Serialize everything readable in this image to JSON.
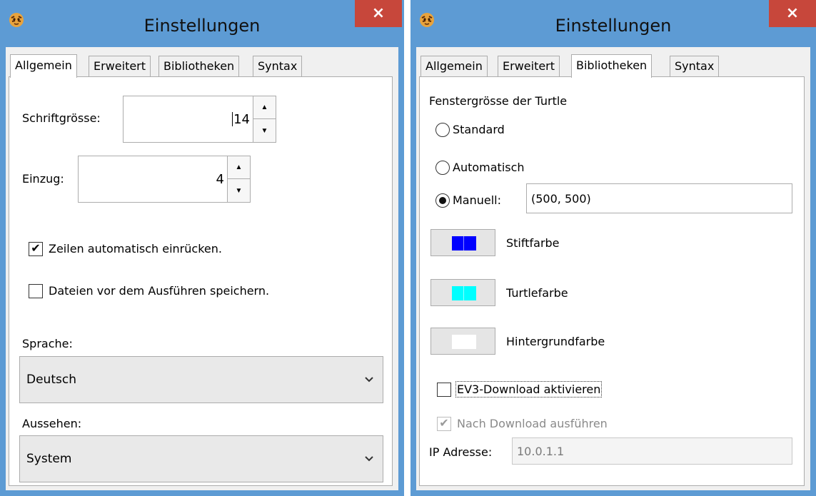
{
  "left_window": {
    "title": "Einstellungen",
    "close_glyph": "×",
    "tabs": [
      {
        "label": "Allgemein",
        "active": true
      },
      {
        "label": "Erweitert",
        "active": false
      },
      {
        "label": "Bibliotheken",
        "active": false
      },
      {
        "label": "Syntax",
        "active": false
      }
    ],
    "font_size": {
      "label": "Schriftgrösse:",
      "value": "14"
    },
    "indent": {
      "label": "Einzug:",
      "value": "4"
    },
    "auto_indent": {
      "label": "Zeilen automatisch einrücken.",
      "checked": true
    },
    "save_before_run": {
      "label": "Dateien vor dem Ausführen speichern.",
      "checked": false
    },
    "language": {
      "label": "Sprache:",
      "value": "Deutsch"
    },
    "appearance": {
      "label": "Aussehen:",
      "value": "System"
    }
  },
  "right_window": {
    "title": "Einstellungen",
    "close_glyph": "×",
    "tabs": [
      {
        "label": "Allgemein",
        "active": false
      },
      {
        "label": "Erweitert",
        "active": false
      },
      {
        "label": "Bibliotheken",
        "active": true
      },
      {
        "label": "Syntax",
        "active": false
      }
    ],
    "turtle_window_size": {
      "label": "Fenstergrösse der Turtle",
      "standard": "Standard",
      "automatic": "Automatisch",
      "manual": "Manuell:",
      "selected": "manual",
      "manual_value": "(500, 500)"
    },
    "pen_color": {
      "label": "Stiftfarbe",
      "color": "#0000ff"
    },
    "turtle_color": {
      "label": "Turtlefarbe",
      "color": "#00ffff"
    },
    "background_color": {
      "label": "Hintergrundfarbe",
      "color": "#ffffff"
    },
    "ev3_download": {
      "label": "EV3-Download aktivieren",
      "checked": false
    },
    "run_after_download": {
      "label": "Nach Download ausführen",
      "checked": true,
      "disabled": true
    },
    "ip_address": {
      "label": "IP Adresse:",
      "value": "10.0.1.1"
    }
  },
  "icons": {
    "app": "tiger-app-icon",
    "close": "close-icon",
    "dropdown": "chevron-down-icon"
  },
  "colors": {
    "titlebar": "#5d9bd4",
    "close_button": "#c7473b",
    "panel": "#ffffff",
    "dialog_bg": "#f0f0f0"
  }
}
